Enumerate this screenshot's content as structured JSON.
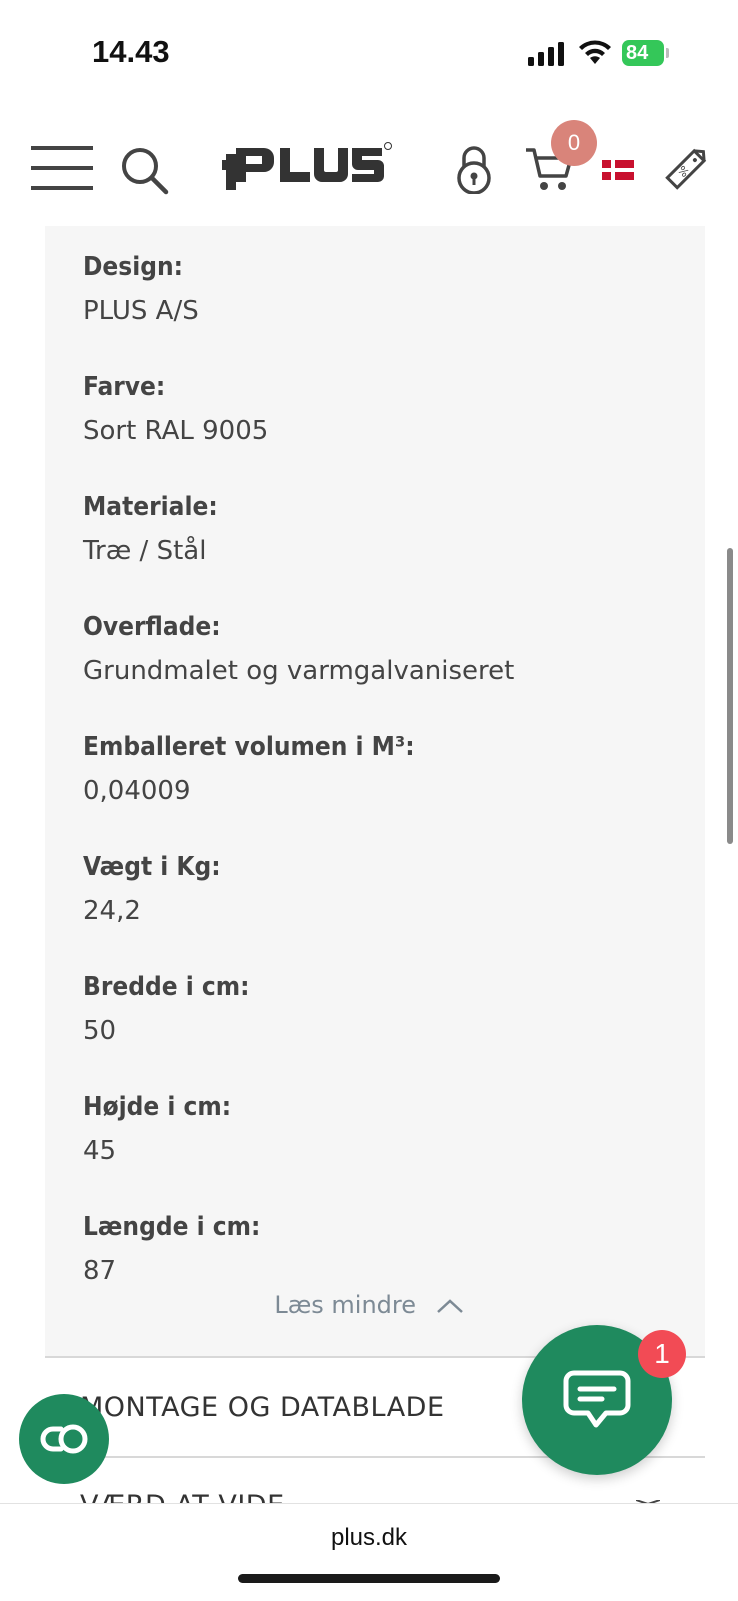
{
  "status_bar": {
    "time": "14.43",
    "battery": "84"
  },
  "nav": {
    "brand": "PLUS",
    "cart_count": "0"
  },
  "specs": [
    {
      "label": "Design:",
      "value": "PLUS A/S"
    },
    {
      "label": "Farve:",
      "value": "Sort RAL 9005"
    },
    {
      "label": "Materiale:",
      "value": "Træ / Stål"
    },
    {
      "label": "Overflade:",
      "value": "Grundmalet og varmgalvaniseret"
    },
    {
      "label": "Emballeret volumen i M³:",
      "value": "0,04009"
    },
    {
      "label": "Vægt i Kg:",
      "value": "24,2"
    },
    {
      "label": "Bredde i cm:",
      "value": "50"
    },
    {
      "label": "Højde i cm:",
      "value": "45"
    },
    {
      "label": "Længde i cm:",
      "value": "87"
    }
  ],
  "read_less": "Læs mindre",
  "accordions": [
    {
      "label": "MONTAGE OG DATABLADE"
    },
    {
      "label": "VÆRD AT VIDE"
    }
  ],
  "chat": {
    "badge": "1"
  },
  "browser": {
    "url": "plus.dk"
  },
  "colors": {
    "accent_green": "#1f8a5e",
    "cart_badge": "#d9847a",
    "chat_badge": "#f24b55",
    "panel_bg": "#f6f6f6"
  }
}
